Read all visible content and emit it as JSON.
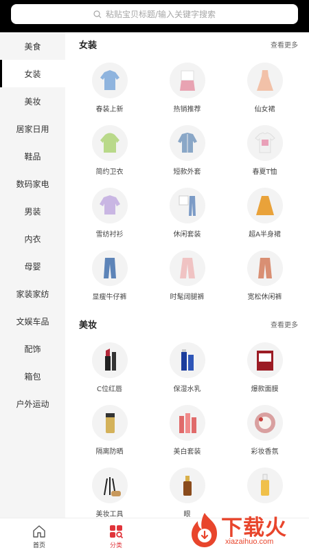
{
  "search": {
    "placeholder": "粘贴宝贝标题/输入关键字搜索"
  },
  "sidebar": {
    "items": [
      {
        "label": "美食"
      },
      {
        "label": "女装"
      },
      {
        "label": "美妆"
      },
      {
        "label": "居家日用"
      },
      {
        "label": "鞋品"
      },
      {
        "label": "数码家电"
      },
      {
        "label": "男装"
      },
      {
        "label": "内衣"
      },
      {
        "label": "母婴"
      },
      {
        "label": "家装家纺"
      },
      {
        "label": "文娱车品"
      },
      {
        "label": "配饰"
      },
      {
        "label": "箱包"
      },
      {
        "label": "户外运动"
      }
    ],
    "active_index": 1
  },
  "sections": [
    {
      "title": "女装",
      "more": "查看更多",
      "items": [
        {
          "label": "春装上新",
          "icon": "blouse-icon",
          "color": "#8fb4de"
        },
        {
          "label": "热销推荐",
          "icon": "outfit-icon",
          "color": "#e8a3b2"
        },
        {
          "label": "仙女裙",
          "icon": "dress-icon",
          "color": "#f2c1a8"
        },
        {
          "label": "简约卫衣",
          "icon": "hoodie-icon",
          "color": "#b9d98a"
        },
        {
          "label": "短款外套",
          "icon": "denim-jacket-icon",
          "color": "#8aa7c7"
        },
        {
          "label": "春夏T恤",
          "icon": "tshirt-icon",
          "color": "#f1f1f1"
        },
        {
          "label": "雪纺衬衫",
          "icon": "chiffon-shirt-icon",
          "color": "#c9b6e3"
        },
        {
          "label": "休闲套装",
          "icon": "casual-set-icon",
          "color": "#e4e4e4"
        },
        {
          "label": "超A半身裙",
          "icon": "skirt-icon",
          "color": "#e9a23a"
        },
        {
          "label": "显瘦牛仔裤",
          "icon": "jeans-icon",
          "color": "#5d84b8"
        },
        {
          "label": "时髦阔腿裤",
          "icon": "wide-pants-icon",
          "color": "#f0c3c3"
        },
        {
          "label": "宽松休闲裤",
          "icon": "loose-pants-icon",
          "color": "#d98f73"
        }
      ]
    },
    {
      "title": "美妆",
      "more": "查看更多",
      "items": [
        {
          "label": "C位红唇",
          "icon": "lipstick-icon",
          "color": "#b3283a"
        },
        {
          "label": "保湿水乳",
          "icon": "lotion-icon",
          "color": "#1c3d9c"
        },
        {
          "label": "爆款面膜",
          "icon": "face-mask-icon",
          "color": "#9b1b24"
        },
        {
          "label": "隔离防晒",
          "icon": "sunscreen-icon",
          "color": "#d4b25a"
        },
        {
          "label": "美白套装",
          "icon": "whitening-set-icon",
          "color": "#e06a6a"
        },
        {
          "label": "彩妆香氛",
          "icon": "palette-icon",
          "color": "#d9a0a0"
        },
        {
          "label": "美妆工具",
          "icon": "brush-icon",
          "color": "#c7985c"
        },
        {
          "label": "眼",
          "icon": "eye-serum-icon",
          "color": "#8a4b1c"
        },
        {
          "label": "",
          "icon": "essence-icon",
          "color": "#f0c04a"
        }
      ]
    }
  ],
  "tabbar": {
    "tabs": [
      {
        "label": "首页",
        "icon": "home-icon"
      },
      {
        "label": "分类",
        "icon": "category-icon"
      }
    ],
    "active_color": "#e0343a"
  },
  "watermark": {
    "text": "下载火",
    "sub": "xiazaihuo.com",
    "color": "#e8452c"
  }
}
